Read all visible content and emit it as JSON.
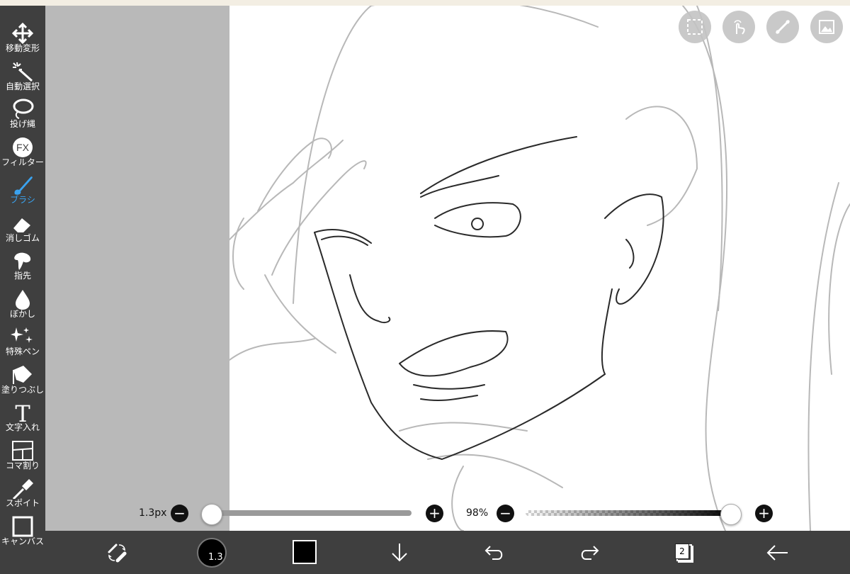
{
  "toolbar": {
    "tools": [
      {
        "label": "移動変形",
        "icon": "move-icon"
      },
      {
        "label": "自動選択",
        "icon": "magic-wand-icon"
      },
      {
        "label": "投げ縄",
        "icon": "lasso-icon"
      },
      {
        "label": "フィルター",
        "icon": "fx-icon",
        "icon_text": "FX"
      },
      {
        "label": "ブラシ",
        "icon": "brush-icon",
        "active": true
      },
      {
        "label": "消しゴム",
        "icon": "eraser-icon"
      },
      {
        "label": "指先",
        "icon": "finger-smudge-icon"
      },
      {
        "label": "ぼかし",
        "icon": "blur-drop-icon"
      },
      {
        "label": "特殊ペン",
        "icon": "sparkle-pen-icon"
      },
      {
        "label": "塗りつぶし",
        "icon": "fill-bucket-icon"
      },
      {
        "label": "文字入れ",
        "icon": "text-icon",
        "icon_text": "T"
      },
      {
        "label": "コマ割り",
        "icon": "frame-divider-icon"
      },
      {
        "label": "スポイト",
        "icon": "eyedropper-icon"
      },
      {
        "label": "キャンバス",
        "icon": "canvas-icon"
      }
    ],
    "active_color": "#3aa3f0"
  },
  "top_buttons": [
    {
      "name": "selection-icon"
    },
    {
      "name": "touch-gesture-icon"
    },
    {
      "name": "ruler-icon"
    },
    {
      "name": "image-icon"
    }
  ],
  "sliders": {
    "size_value": "1.3px",
    "size_level": 0.0,
    "opacity_value": "98%",
    "opacity_level": 0.98,
    "minus": "−",
    "plus": "+"
  },
  "bottom_bar": {
    "brush_size": "1.3",
    "color": "#000000",
    "layer_count": "2",
    "icons": [
      "swap-brush-eraser-icon",
      "brush-size-icon",
      "color-swatch-icon",
      "download-icon",
      "undo-icon",
      "redo-icon",
      "layers-icon",
      "back-arrow-icon"
    ]
  }
}
